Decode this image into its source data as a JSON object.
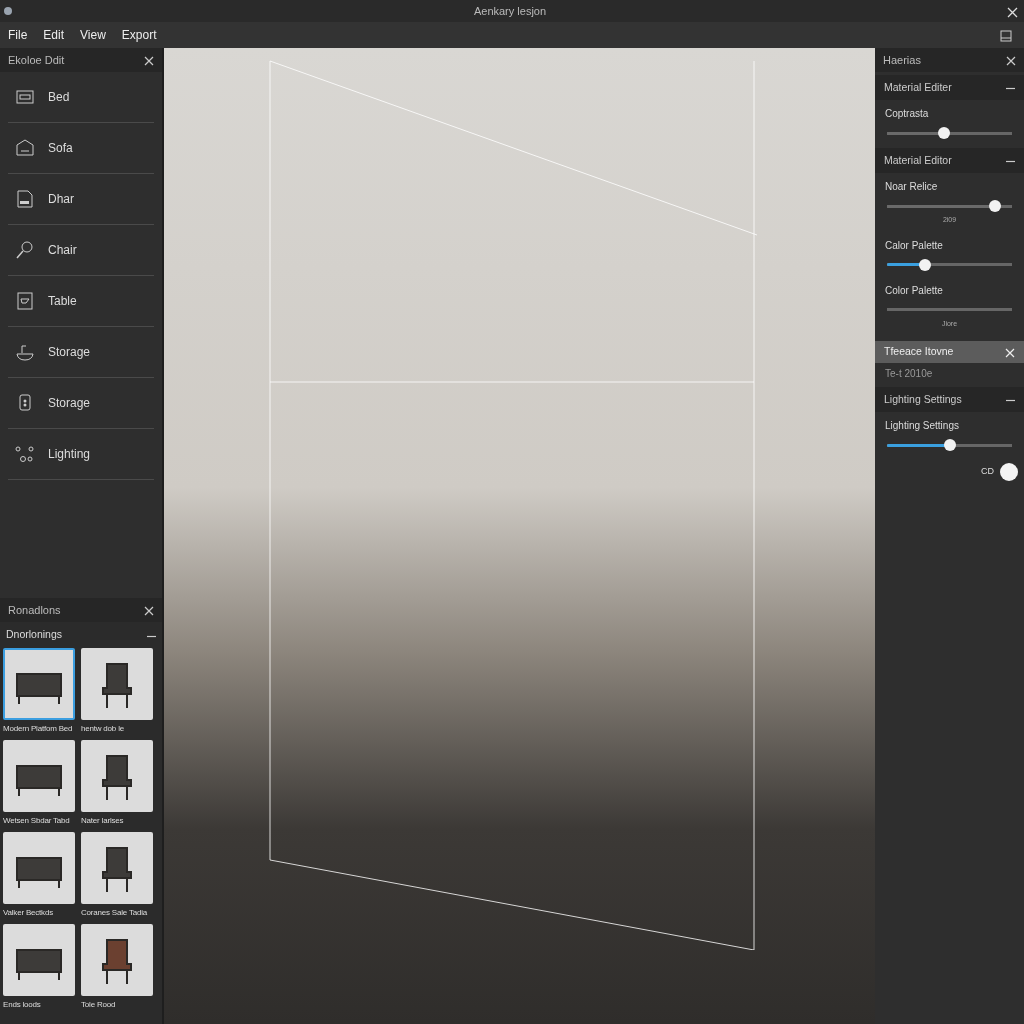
{
  "window": {
    "title": "Aenkary lesjon"
  },
  "menu": [
    "File",
    "Edit",
    "View",
    "Export"
  ],
  "left_panel": {
    "title": "Ekoloe Ddit",
    "items": [
      {
        "label": "Bed"
      },
      {
        "label": "Sofa"
      },
      {
        "label": "Dhar"
      },
      {
        "label": "Chair"
      },
      {
        "label": "Table"
      },
      {
        "label": "Storage"
      },
      {
        "label": "Storage"
      },
      {
        "label": "Lighting"
      }
    ]
  },
  "library_panel": {
    "title": "Ronadlons",
    "section": "Dnorlonings",
    "items": [
      {
        "caption": "Modern Platfom Bed",
        "selected": true
      },
      {
        "caption": "hentw dob le",
        "selected": false
      },
      {
        "caption": "Wetsen Sbdar Tabd",
        "selected": false
      },
      {
        "caption": "Nater larlses",
        "selected": false
      },
      {
        "caption": "Valker Bectkds",
        "selected": false
      },
      {
        "caption": "Coranes Sale Tadia",
        "selected": false
      },
      {
        "caption": "Ends loods",
        "selected": false
      },
      {
        "caption": "Tole Rood",
        "selected": false
      }
    ]
  },
  "right_panel": {
    "title": "Haerias",
    "rows": [
      {
        "kind": "section",
        "label": "Material Editer"
      },
      {
        "kind": "slider",
        "label": "Coptrasta",
        "level": 0.45,
        "accent": false
      },
      {
        "kind": "section",
        "label": "Material Editor"
      },
      {
        "kind": "slider",
        "label": "Noar Relice",
        "level": 0.9,
        "accent": false,
        "reading": "2i09"
      },
      {
        "kind": "slider",
        "label": "Calor Palette",
        "level": 0.28,
        "accent": true
      },
      {
        "kind": "track",
        "label": "Color Palette",
        "reading": "Jiore"
      },
      {
        "kind": "header",
        "label": "Tfeeace Itovne"
      },
      {
        "kind": "text",
        "label": "Te-t 2010e"
      },
      {
        "kind": "section",
        "label": "Lighting Settings"
      },
      {
        "kind": "slider",
        "label": "Lighting Settings",
        "level": 0.5,
        "accent": true
      },
      {
        "kind": "toggle",
        "label": "CD",
        "on": true
      }
    ]
  }
}
